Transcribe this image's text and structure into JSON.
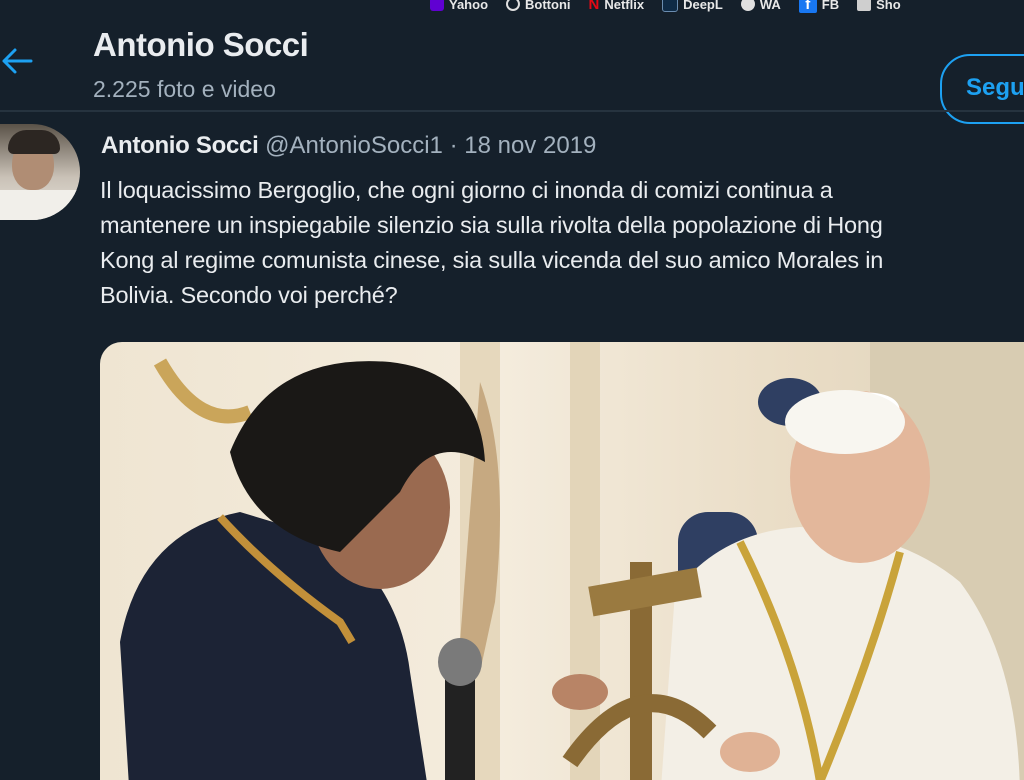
{
  "bookmarks": [
    {
      "label": "Yahoo",
      "icon": "yahoo-icon",
      "color": "#6001d2"
    },
    {
      "label": "Bottoni",
      "icon": "bookmark-icon",
      "color": "#e0e0e0"
    },
    {
      "label": "Netflix",
      "icon": "netflix-icon",
      "color": "#e50914"
    },
    {
      "label": "DeepL",
      "icon": "deepl-icon",
      "color": "#0f2b46"
    },
    {
      "label": "WA",
      "icon": "whatsapp-icon",
      "color": "#e0e0e0"
    },
    {
      "label": "FB",
      "icon": "facebook-icon",
      "color": "#1877f2"
    },
    {
      "label": "Sho",
      "icon": "folder-icon",
      "color": "#cfcfcf"
    }
  ],
  "header": {
    "back_icon": "back-arrow-icon",
    "name": "Antonio Socci",
    "media_count": "2.225 foto e video",
    "follow_label": "Segu"
  },
  "tweet": {
    "author": "Antonio Socci",
    "handle": "@AntonioSocci1",
    "separator": "·",
    "date": "18 nov 2019",
    "lines": [
      "Il loquacissimo Bergoglio, che ogni giorno ci inonda di comizi continua a",
      "mantenere un inspiegabile silenzio sia sulla rivolta della popolazione di Hong",
      "Kong al regime comunista cinese, sia sulla vicenda del suo amico Morales in",
      "Bolivia. Secondo voi perché?"
    ]
  },
  "colors": {
    "background": "#15202b",
    "accent": "#1da1f2",
    "text_primary": "#e9ecef",
    "text_secondary": "#a3b1be"
  }
}
